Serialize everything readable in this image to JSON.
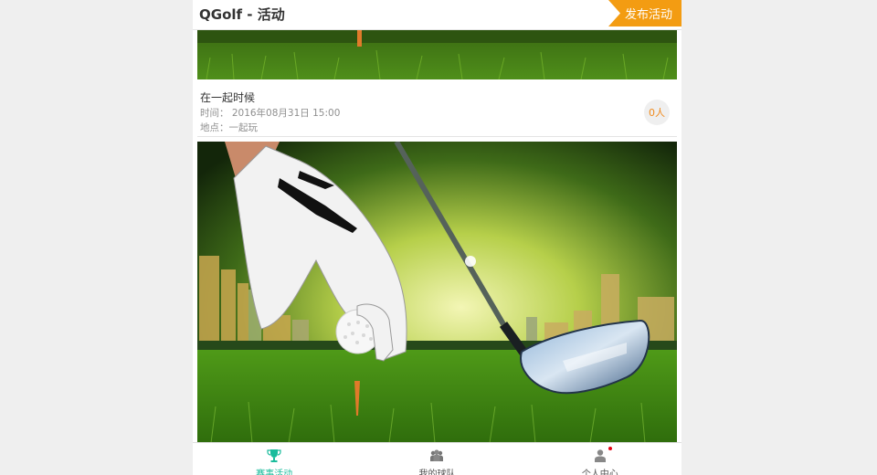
{
  "header": {
    "title": "QGolf - 活动",
    "publish_button": "发布活动"
  },
  "events": [
    {
      "name": "在一起时候",
      "time": "时间：  2016年08月31日 15:00",
      "place": "地点：一起玩",
      "count": "0人"
    }
  ],
  "bottom_nav": [
    {
      "label": "赛事活动",
      "icon": "trophy-icon",
      "active": true
    },
    {
      "label": "我的球队",
      "icon": "team-icon",
      "active": false
    },
    {
      "label": "个人中心",
      "icon": "person-icon",
      "active": false,
      "notification_dot": true
    }
  ],
  "colors": {
    "accent_orange": "#f39c12",
    "active_green": "#1abc9c",
    "count_orange": "#f08a1c",
    "notification_red": "#e60012"
  }
}
